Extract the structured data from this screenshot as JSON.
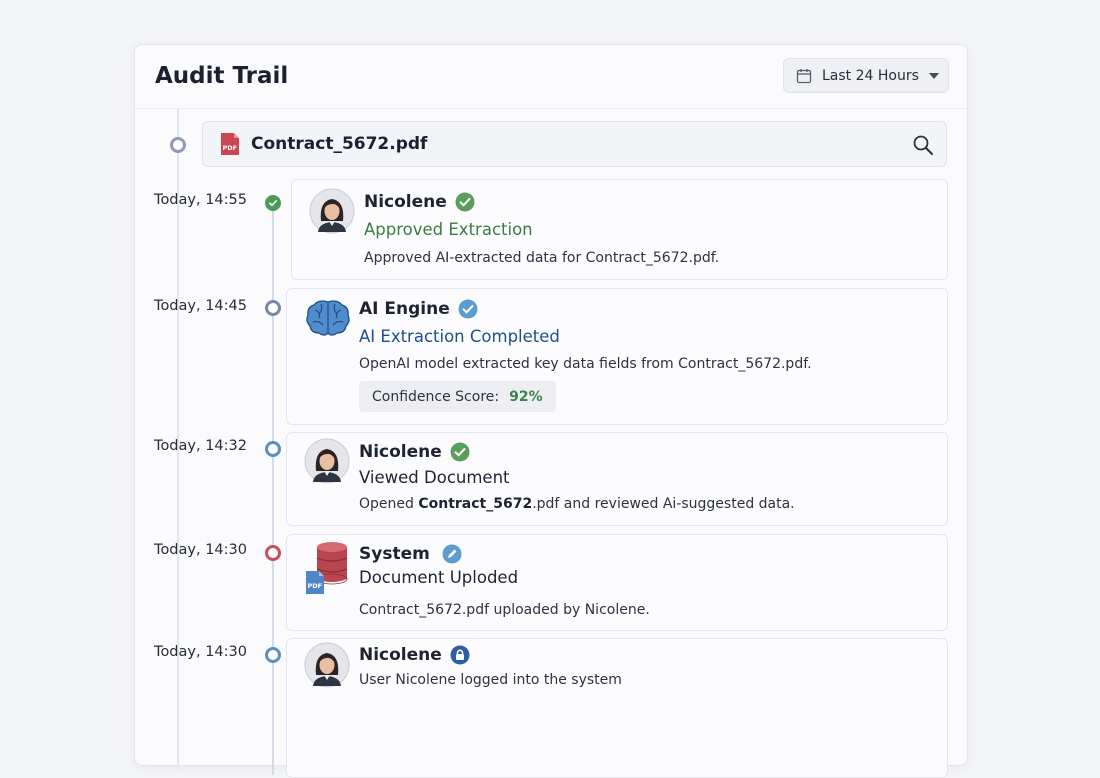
{
  "header": {
    "title": "Audit Trail",
    "range_label": "Last 24 Hours"
  },
  "file": {
    "name": "Contract_5672.pdf",
    "icon_text": "PDF"
  },
  "events": [
    {
      "time": "Today, 14:55",
      "actor": "Nicolene",
      "action": "Approved Extraction",
      "description": "Approved AI-extracted data for Contract_5672.pdf.",
      "action_color": "#3d7b45"
    },
    {
      "time": "Today, 14:45",
      "actor": "AI Engine",
      "action": "AI Extraction Completed",
      "description": "OpenAI model extracted key data fields from Contract_5672.pdf.",
      "confidence_label": "Confidence Score:",
      "confidence_value": "92%",
      "action_color": "#1f4e8c"
    },
    {
      "time": "Today, 14:32",
      "actor": "Nicolene",
      "action": "Viewed Document",
      "description_pre": "Opened ",
      "description_bold": "Contract_5672",
      "description_post": ".pdf and reviewed Ai-suggested data.",
      "action_color": "#1d2330"
    },
    {
      "time": "Today, 14:30",
      "actor": "System",
      "action": "Document Uploded",
      "description": "Contract_5672.pdf uploaded by Nicolene.",
      "icon_text": "PDF",
      "action_color": "#1d2330"
    },
    {
      "time": "Today, 14:30",
      "actor": "Nicolene",
      "description": "User Nicolene logged into the system"
    }
  ]
}
